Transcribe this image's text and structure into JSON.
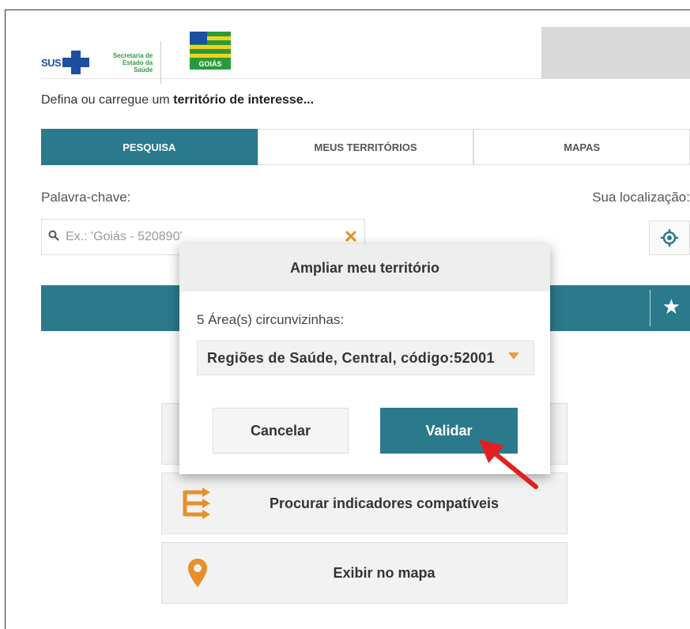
{
  "header": {
    "sus_text": "SUS",
    "secretaria_line1": "Secretaria de",
    "secretaria_line2": "Estado da",
    "secretaria_line3": "Saúde",
    "goias_name": "GOIÁS"
  },
  "intro": {
    "prefix": "Defina ou carregue um ",
    "bold": "território de interesse..."
  },
  "tabs": [
    {
      "label": "PESQUISA",
      "active": true
    },
    {
      "label": "MEUS TERRITÓRIOS",
      "active": false
    },
    {
      "label": "MAPAS",
      "active": false
    }
  ],
  "search": {
    "keyword_label": "Palavra-chave:",
    "placeholder": "Ex.: 'Goiás - 520890'",
    "location_label": "Sua localização:"
  },
  "actions": [
    {
      "label": "Procurar indicadores compatíveis",
      "icon": "branch-arrows-icon"
    },
    {
      "label": "Exibir no mapa",
      "icon": "map-pin-icon"
    }
  ],
  "modal": {
    "title": "Ampliar meu território",
    "areas_label": "5 Área(s) circunvizinhas:",
    "selected_value": "Regiões de Saúde, Central, código:52001",
    "cancel_label": "Cancelar",
    "validate_label": "Validar"
  },
  "colors": {
    "teal": "#2a7a8c",
    "orange": "#e6902a",
    "arrow_red": "#e02020"
  }
}
